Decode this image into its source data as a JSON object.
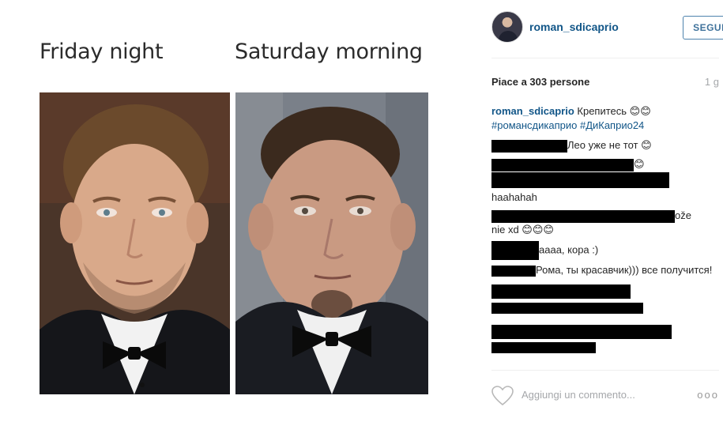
{
  "post": {
    "caption_left": "Friday night",
    "caption_right": "Saturday morning"
  },
  "header": {
    "username": "roman_sdicaprio",
    "follow_label": "SEGUI"
  },
  "stats": {
    "likes": "Piace a 303 persone",
    "time": "1 g"
  },
  "comments": [
    {
      "user": "roman_sdicaprio",
      "text": "Крепитесь 😊😊",
      "hashtags": "#романсдикаприо #ДиКаприо24"
    },
    {
      "text": "Лео уже не тот 😊"
    },
    {
      "text": "😊"
    },
    {
      "text": ""
    },
    {
      "text": "haahahah"
    },
    {
      "text": "ože"
    },
    {
      "text": "nie xd 😊😊😊"
    },
    {
      "text": "аааа, кора :)"
    },
    {
      "text": "Рома, ты красавчик))) все получится!"
    },
    {
      "text": ""
    },
    {
      "text": ""
    },
    {
      "text": ""
    },
    {
      "text": ""
    }
  ],
  "footer": {
    "add_comment_placeholder": "Aggiungi un commento...",
    "more_label": "ooo"
  },
  "colors": {
    "link": "#125688",
    "follow_border": "#4e83ad",
    "muted": "#a5a7aa"
  },
  "icons": [
    "heart-icon",
    "more-options-icon"
  ]
}
